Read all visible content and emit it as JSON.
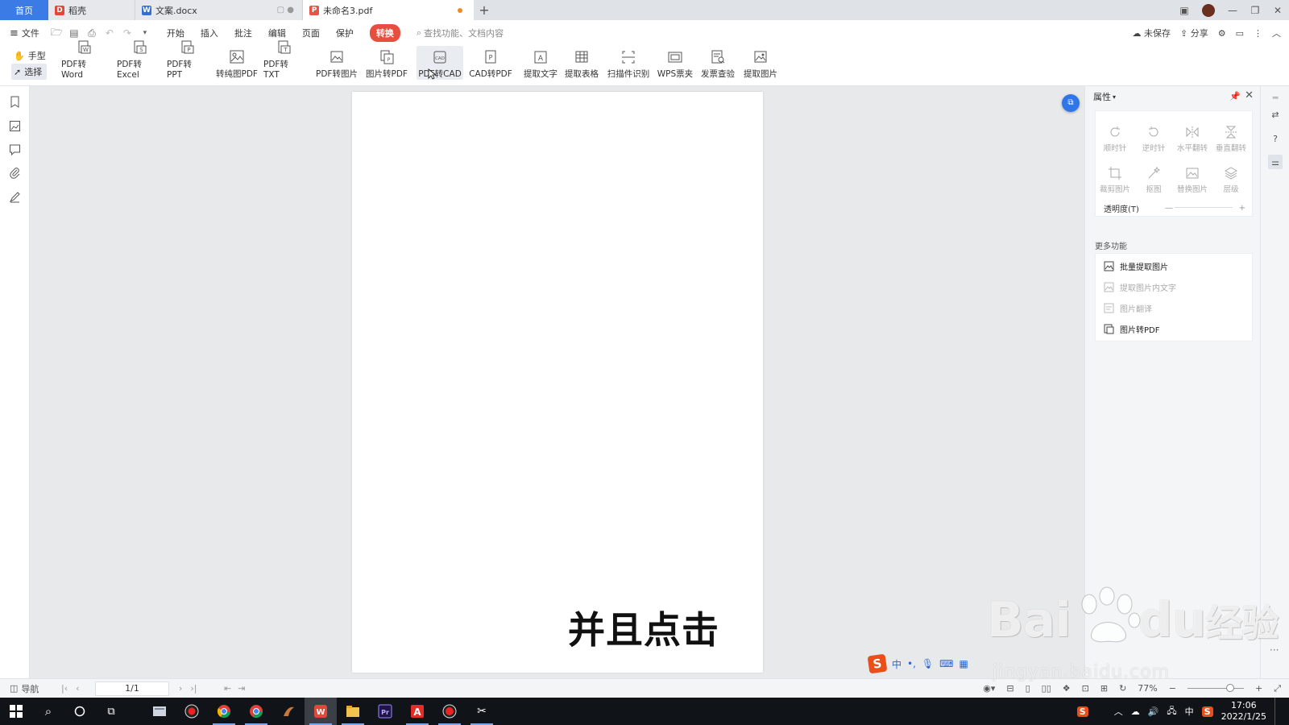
{
  "tabs": [
    {
      "label": "首页"
    },
    {
      "label": "稻壳"
    },
    {
      "label": "文案.docx"
    },
    {
      "label": "未命名3.pdf"
    }
  ],
  "menu": {
    "file": "文件",
    "items": [
      "开始",
      "插入",
      "批注",
      "编辑",
      "页面",
      "保护"
    ],
    "active": "转换",
    "search_placeholder": "查找功能、文档内容",
    "unsaved": "未保存",
    "share": "分享"
  },
  "modes": {
    "hand": "手型",
    "select": "选择"
  },
  "ribbon": [
    "PDF转Word",
    "PDF转Excel",
    "PDF转PPT",
    "转纯图PDF",
    "PDF转TXT",
    "PDF转图片",
    "图片转PDF",
    "PDF转CAD",
    "CAD转PDF",
    "提取文字",
    "提取表格",
    "扫描件识别",
    "WPS票夹",
    "发票查验",
    "提取图片"
  ],
  "props": {
    "title": "属性",
    "tools": [
      "顺时针",
      "逆时针",
      "水平翻转",
      "垂直翻转",
      "裁剪图片",
      "抠图",
      "替换图片",
      "层级"
    ],
    "opacity": "透明度(T)",
    "more_title": "更多功能",
    "more": [
      {
        "label": "批量提取图片",
        "enabled": true
      },
      {
        "label": "提取图片内文字",
        "enabled": false
      },
      {
        "label": "图片翻译",
        "enabled": false
      },
      {
        "label": "图片转PDF",
        "enabled": true
      }
    ]
  },
  "caption": "并且点击",
  "status": {
    "nav": "导航",
    "page": "1/1",
    "zoom": "77%"
  },
  "ime": {
    "lang": "中"
  },
  "watermark": {
    "main": "Bai",
    "du": "du",
    "jingyan": "经验",
    "sub": "jingyan.baidu.com"
  },
  "taskbar": {
    "time": "17:06",
    "date": "2022/1/25",
    "lang": "中"
  },
  "colors": {
    "accent": "#3a7be6",
    "convert_tab": "#e84e3d",
    "taskbar": "#101318"
  }
}
